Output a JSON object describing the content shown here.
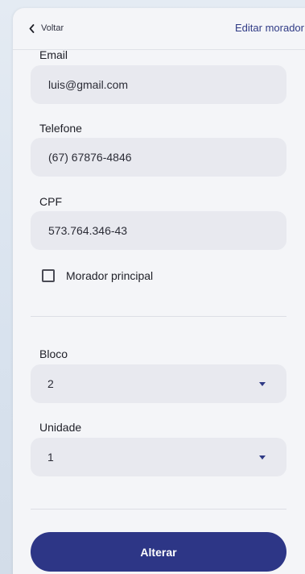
{
  "header": {
    "back_label": "Voltar",
    "title": "Editar morador"
  },
  "form": {
    "email": {
      "label": "Email",
      "value": "luis@gmail.com"
    },
    "phone": {
      "label": "Telefone",
      "value": "(67) 67876-4846"
    },
    "cpf": {
      "label": "CPF",
      "value": "573.764.346-43"
    },
    "main_resident": {
      "label": "Morador principal",
      "checked": false
    },
    "block": {
      "label": "Bloco",
      "selected": "2"
    },
    "unit": {
      "label": "Unidade",
      "selected": "1"
    },
    "submit_label": "Alterar"
  },
  "icons": {
    "back": "chevron-left-icon",
    "dropdown": "caret-down-icon"
  },
  "colors": {
    "accent": "#2d3686",
    "field_bg": "#e8e9ef",
    "page_bg": "#f4f5f8"
  }
}
